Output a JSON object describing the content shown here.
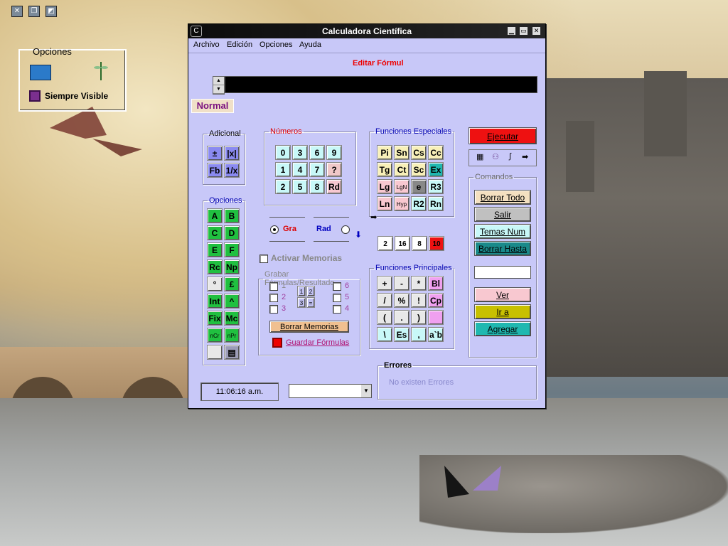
{
  "desktop": {
    "sys_icons": [
      "close-icon",
      "restore-icon",
      "edit-icon"
    ],
    "options_panel": {
      "title": "Opciones",
      "checkbox_label": "Siempre Visible"
    }
  },
  "window": {
    "title": "Calculadora Científica",
    "menu": [
      "Archivo",
      "Edición",
      "Opciones",
      "Ayuda"
    ],
    "formula_title": "Editar Fórmul",
    "mode_tab": "Normal",
    "execute_label": "Ejecutar",
    "groups": {
      "adicional": {
        "legend": "Adicional",
        "buttons": [
          "±",
          "|x|",
          "Fb",
          "1/x"
        ]
      },
      "numeros": {
        "legend": "Números",
        "buttons": [
          "0",
          "3",
          "6",
          "9",
          "1",
          "4",
          "7",
          "?",
          "2",
          "5",
          "8",
          "Rd"
        ]
      },
      "especiales": {
        "legend": "Funciones Especiales",
        "buttons": [
          "Pi",
          "Sn",
          "Cs",
          "Cc",
          "Tg",
          "Ct",
          "Sc",
          "Ex",
          "Lg",
          "LgN",
          "e",
          "R3",
          "Ln",
          "Hyp",
          "R2",
          "Rn"
        ]
      },
      "opciones": {
        "legend": "Opciones",
        "buttons": [
          "A",
          "B",
          "C",
          "D",
          "E",
          "F",
          "Rc",
          "Np",
          "°",
          "£",
          "Int",
          "^",
          "Fix",
          "Mc",
          "nCr",
          "nPr"
        ]
      },
      "angle": {
        "gra": "Gra",
        "rad": "Rad"
      },
      "bases": [
        "2",
        "16",
        "8",
        "10"
      ],
      "memorias": {
        "label": "Activar Memorias"
      },
      "grabar": {
        "legend": "Grabar Fórmulas/Resultado",
        "left": [
          "1",
          "2",
          "3"
        ],
        "right": [
          "6",
          "5",
          "4"
        ],
        "grid": [
          "1",
          "2",
          "3",
          "="
        ],
        "borrar_label": "Borrar Memorias",
        "guardar_label": "Guardar Fórmulas"
      },
      "principales": {
        "legend": "Funciones Principales",
        "buttons": [
          "+",
          "-",
          "*",
          "Bl",
          "/",
          "%",
          "!",
          "Cp",
          "(",
          ".",
          ")",
          "",
          "\\",
          "Es",
          ",",
          "a`b"
        ]
      },
      "comandos": {
        "legend": "Comandos",
        "buttons": [
          "Borrar Todo",
          "Salir",
          "Temas Num",
          "Borrar Hasta"
        ],
        "nav_buttons": [
          "Ver",
          "Ir a",
          "Agregar"
        ]
      },
      "errores": {
        "legend": "Errores",
        "text": "No existen Errores"
      }
    },
    "clock": "11:06:16 a.m.",
    "colors": {
      "window_bg": "#c8c8f8",
      "formula_title": "#e00000",
      "execute_bg": "#ee1111"
    }
  }
}
